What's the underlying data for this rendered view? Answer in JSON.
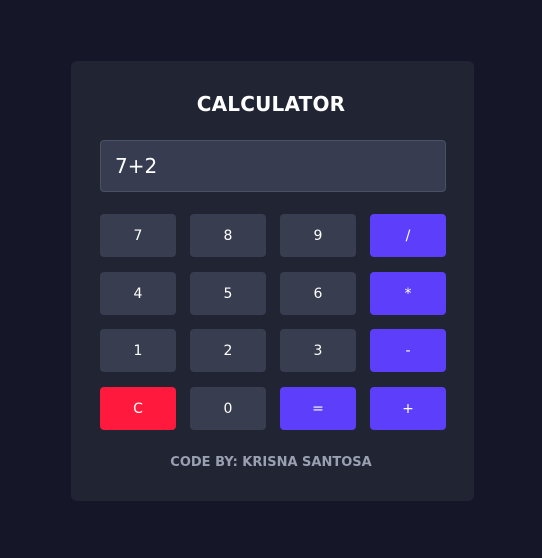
{
  "app": {
    "title": "CALCULATOR",
    "display_value": "7+2",
    "footer": "CODE BY: KRISNA SANTOSA"
  },
  "buttons": {
    "row1": [
      "7",
      "8",
      "9",
      "/"
    ],
    "row2": [
      "4",
      "5",
      "6",
      "*"
    ],
    "row3": [
      "1",
      "2",
      "3",
      "-"
    ],
    "row4": [
      "C",
      "0",
      "=",
      "+"
    ]
  },
  "colors": {
    "background": "#151728",
    "card": "#212533",
    "button": "#383d50",
    "operator": "#5d3ffb",
    "clear": "#ff1a3d",
    "footer_text": "#9a9fb2"
  }
}
